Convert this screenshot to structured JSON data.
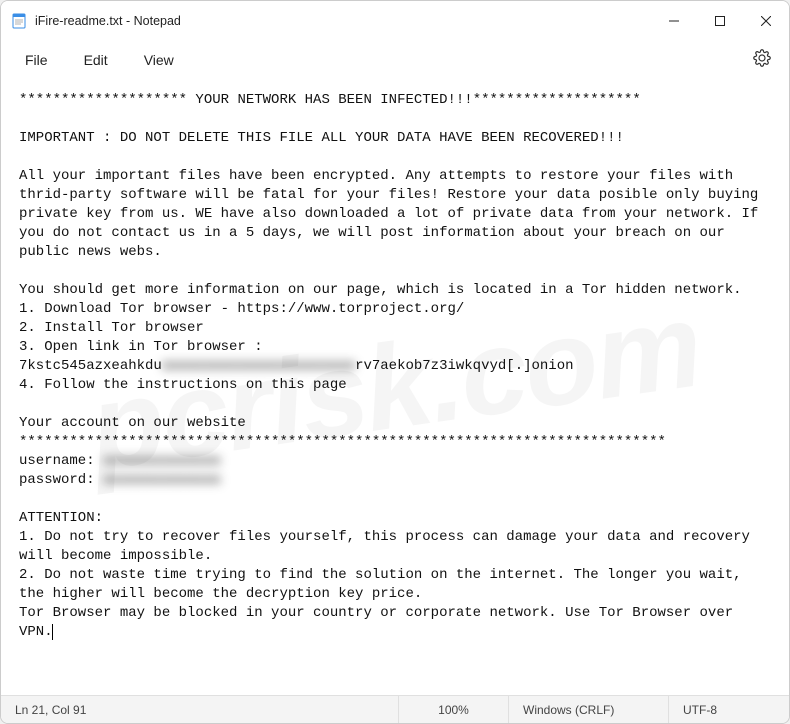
{
  "window": {
    "title": "iFire-readme.txt - Notepad"
  },
  "menubar": {
    "items": [
      "File",
      "Edit",
      "View"
    ]
  },
  "note": {
    "header_stars_left": "********************",
    "header_title": " YOUR NETWORK HAS BEEN INFECTED!!!",
    "header_stars_right": "********************",
    "important": "IMPORTANT : DO NOT DELETE THIS FILE ALL YOUR DATA HAVE BEEN RECOVERED!!!",
    "para1": "All your important files have been encrypted. Any attempts to restore your files with thrid-party software will be fatal for your files! Restore your data posible only buying private key from us. WE have also downloaded a lot of private data from your network. If you do not contact us in a 5 days, we will post information about your breach on our public news webs.",
    "para2_intro": "You should get more information on our page, which is located in a Tor hidden network.",
    "step1": "1. Download Tor browser - https://www.torproject.org/",
    "step2": "2. Install Tor browser",
    "step3": "3. Open link in Tor browser :",
    "onion_prefix": "7kstc545azxeahkdu",
    "onion_blurred": "aaaaaaaaaaaaaaaaaaaaaaa",
    "onion_suffix": "rv7aekob7z3iwkqvyd[.]onion",
    "step4": "4. Follow the instructions on this page",
    "account_label": "Your account on our website",
    "account_stars": "*****************************************************************************",
    "username_label": "username: ",
    "username_blurred": "aaaaaaaaaaaaaa",
    "password_label": "password: ",
    "password_blurred": "aaaaaaaaaaaaaa",
    "attention_label": "ATTENTION:",
    "attn1": "1. Do not try to recover files yourself, this process can damage your data and recovery will become impossible.",
    "attn2": "2. Do not waste time trying to find the solution on the internet. The longer you wait, the higher will become the decryption key price.",
    "tor_note": "Tor Browser may be blocked in your country or corporate network. Use Tor Browser over VPN."
  },
  "statusbar": {
    "position": "Ln 21, Col 91",
    "zoom": "100%",
    "line_ending": "Windows (CRLF)",
    "encoding": "UTF-8"
  },
  "watermark": "pcrisk.com"
}
